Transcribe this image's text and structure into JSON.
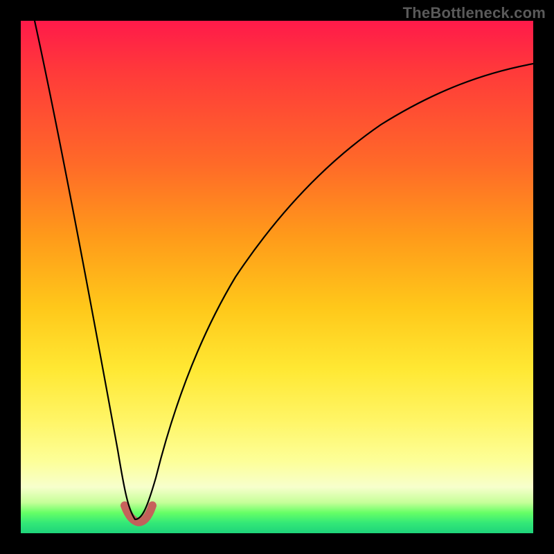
{
  "watermark": "TheBottleneck.com",
  "colors": {
    "frame": "#000000",
    "curve": "#000000",
    "valley_highlight": "#c85a5a",
    "gradient_top": "#ff1a4a",
    "gradient_bottom": "#1ed47a"
  },
  "chart_data": {
    "type": "line",
    "title": "",
    "xlabel": "",
    "ylabel": "",
    "xlim": [
      0,
      100
    ],
    "ylim": [
      0,
      100
    ],
    "grid": false,
    "x": [
      0,
      5,
      10,
      15,
      18,
      20,
      22,
      24,
      25,
      26,
      28,
      30,
      35,
      40,
      50,
      60,
      70,
      80,
      90,
      100
    ],
    "values": [
      100,
      80,
      60,
      35,
      15,
      5,
      0,
      0,
      1,
      5,
      15,
      25,
      43,
      55,
      70,
      78,
      84,
      88,
      90,
      92
    ],
    "notes": "V-shaped bottleneck curve. Minimum (optimal/green zone) occurs near x≈22. Left branch descends sharply from 100; right branch rises with diminishing slope toward ~92. Y-axis color-coded: high values red (bad), low values green (good). Valley floor highlighted in muted red.",
    "valley_range_x": [
      20,
      26
    ]
  }
}
